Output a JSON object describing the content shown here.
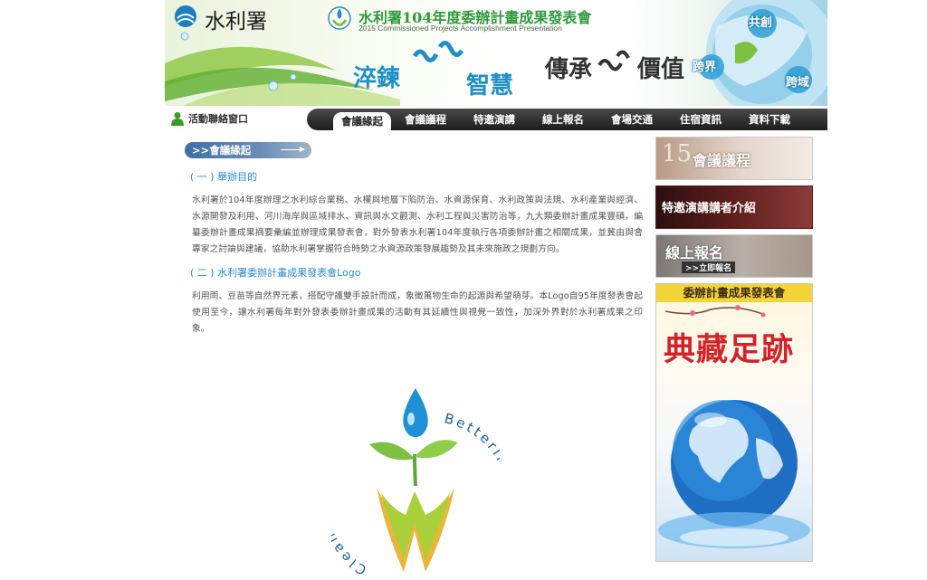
{
  "header": {
    "org_logo_text": "水利署",
    "conference_title": "水利署104年度委辦計畫成果發表會",
    "conference_subtitle": "2015 Commissioned Projects Accomplishment Presentation",
    "slogan_left_1": "淬鍊",
    "slogan_left_2": "智慧",
    "slogan_right_1": "傳承",
    "slogan_right_2": "價值",
    "bubbles": [
      "共創",
      "跨界",
      "跨域"
    ]
  },
  "nav": {
    "contact_label": "活動聯絡窗口",
    "items": [
      "會議緣起",
      "會議議程",
      "特邀演講",
      "線上報名",
      "會場交通",
      "住宿資訊",
      "資料下載"
    ],
    "active_index": 0
  },
  "main": {
    "section_label": ">>會議緣起",
    "heading1": "( 一 ) 舉辦目的",
    "paragraph1": "水利署於104年度辦理之水利綜合業務、水權與地層下陷防治、水資源保育、水利政策與法規、水利產業與經濟、水源開發及利用、河川海岸與區域排水、資訊與水文觀測、水利工程與災害防治等，九大類委辦計畫成果豐碩，編纂委辦計畫成果摘要彙編並辦理成果發表會，對外發表水利署104年度執行各項委辦計畫之相關成果，並冀由與會專家之討論與建議，協助水利署掌握符合時勢之水資源政策發展趨勢及其未來施政之規劃方向。",
    "heading2": "( 二 ) 水利署委辦計畫成果發表會Logo",
    "paragraph2": "利用雨、豆苗等自然界元素，搭配守護雙手設計而成，象徵萬物生命的起源與希望萌芽。本Logo自95年度發表會起使用至今，讓水利署每年對外發表委辦計畫成果的活動有其延續性與視覺一致性，加深外界對於水利署成果之印象。",
    "logo_ring_left": "Cleanwater",
    "logo_ring_right": "Betterlife"
  },
  "sidebar": {
    "btn_agenda": "會議議程",
    "btn_agenda_num": "15",
    "btn_speakers": "特邀演講講者介紹",
    "btn_register": "線上報名",
    "btn_register_sub": ">>立即報名",
    "poster_title": "委辦計畫成果發表會",
    "poster_big": "典藏足跡"
  },
  "colors": {
    "accent_blue": "#2a8bd0",
    "nav_dark": "#2a2a2a",
    "poster_red": "#d3232a",
    "poster_yellow": "#f3d437"
  }
}
